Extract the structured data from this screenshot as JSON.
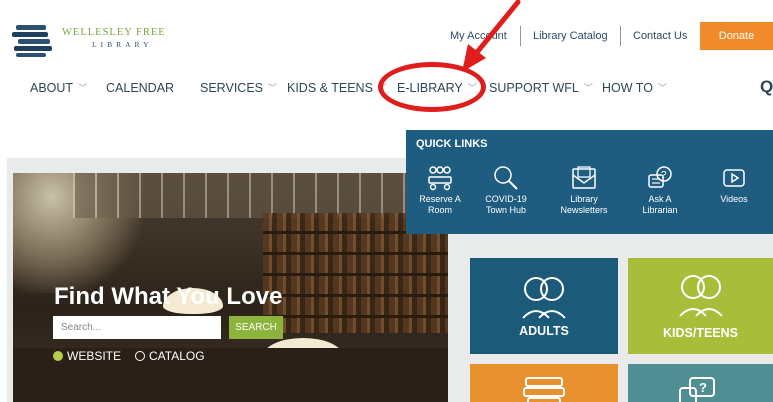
{
  "logo": {
    "title": "WELLESLEY FREE",
    "subtitle": "LIBRARY"
  },
  "utility": {
    "my_account": "My Account",
    "library_catalog": "Library Catalog",
    "contact_us": "Contact Us",
    "donate": "Donate"
  },
  "nav": {
    "items": [
      {
        "label": "ABOUT",
        "has_dropdown": true
      },
      {
        "label": "CALENDAR",
        "has_dropdown": false
      },
      {
        "label": "SERVICES",
        "has_dropdown": true
      },
      {
        "label": "KIDS & TEENS",
        "has_dropdown": true
      },
      {
        "label": "E-LIBRARY",
        "has_dropdown": true
      },
      {
        "label": "SUPPORT WFL",
        "has_dropdown": true
      },
      {
        "label": "HOW TO",
        "has_dropdown": true
      }
    ],
    "search_icon": "Q"
  },
  "quick_links": {
    "title": "QUICK LINKS",
    "items": [
      {
        "label": "Reserve A Room",
        "icon": "people-meeting-icon"
      },
      {
        "label": "COVID-19 Town Hub",
        "icon": "magnifier-icon"
      },
      {
        "label": "Library Newsletters",
        "icon": "envelope-icon"
      },
      {
        "label": "Ask A Librarian",
        "icon": "question-bubble-icon"
      },
      {
        "label": "Videos",
        "icon": "play-icon"
      }
    ]
  },
  "hero": {
    "title": "Find What You Love",
    "search_placeholder": "Search...",
    "search_button": "SEARCH",
    "options": [
      "WEBSITE",
      "CATALOG"
    ],
    "selected_option": "WEBSITE"
  },
  "tiles": [
    {
      "label": "ADULTS",
      "color": "#1c5a79",
      "icon": "adults-icon"
    },
    {
      "label": "KIDS/TEENS",
      "color": "#a8bd3a",
      "icon": "kids-icon"
    },
    {
      "label": "",
      "color": "#e8902d",
      "icon": "books-icon"
    },
    {
      "label": "",
      "color": "#4f8e93",
      "icon": "question-chat-icon"
    }
  ],
  "colors": {
    "accent_green": "#8cb33c",
    "donate_orange": "#f18a2b",
    "navy": "#1f5d80",
    "annotation_red": "#e01c1c"
  }
}
